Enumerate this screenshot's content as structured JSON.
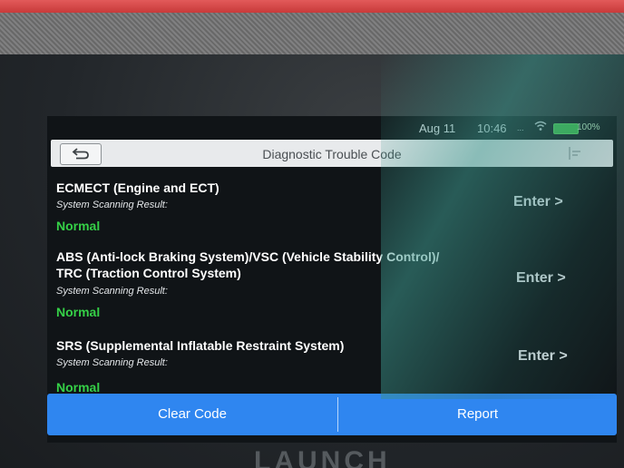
{
  "status_bar": {
    "date": "Aug 11",
    "time": "10:46",
    "signal": "...",
    "battery": "100%"
  },
  "header": {
    "title": "Diagnostic Trouble Code"
  },
  "systems": [
    {
      "name_lines": [
        "ECMECT (Engine and ECT)"
      ],
      "result_label": "System Scanning Result:",
      "status": "Normal",
      "action": "Enter >"
    },
    {
      "name_lines": [
        "ABS (Anti-lock Braking System)/VSC (Vehicle Stability Control)/",
        "TRC (Traction Control System)"
      ],
      "result_label": "System Scanning Result:",
      "status": "Normal",
      "action": "Enter >"
    },
    {
      "name_lines": [
        "SRS (Supplemental Inflatable Restraint System)"
      ],
      "result_label": "System Scanning Result:",
      "status": "Normal",
      "action": "Enter >"
    }
  ],
  "footer": {
    "clear_code": "Clear Code",
    "report": "Report"
  },
  "device": {
    "brand": "LAUNCH"
  },
  "colors": {
    "status_ok": "#35d047",
    "button_bar": "#2f86f0",
    "title_bar": "#e8eaec"
  },
  "icons": {
    "back": "back-arrow-icon",
    "menu": "menu-icon",
    "wifi": "wifi-icon",
    "battery": "battery-icon"
  }
}
